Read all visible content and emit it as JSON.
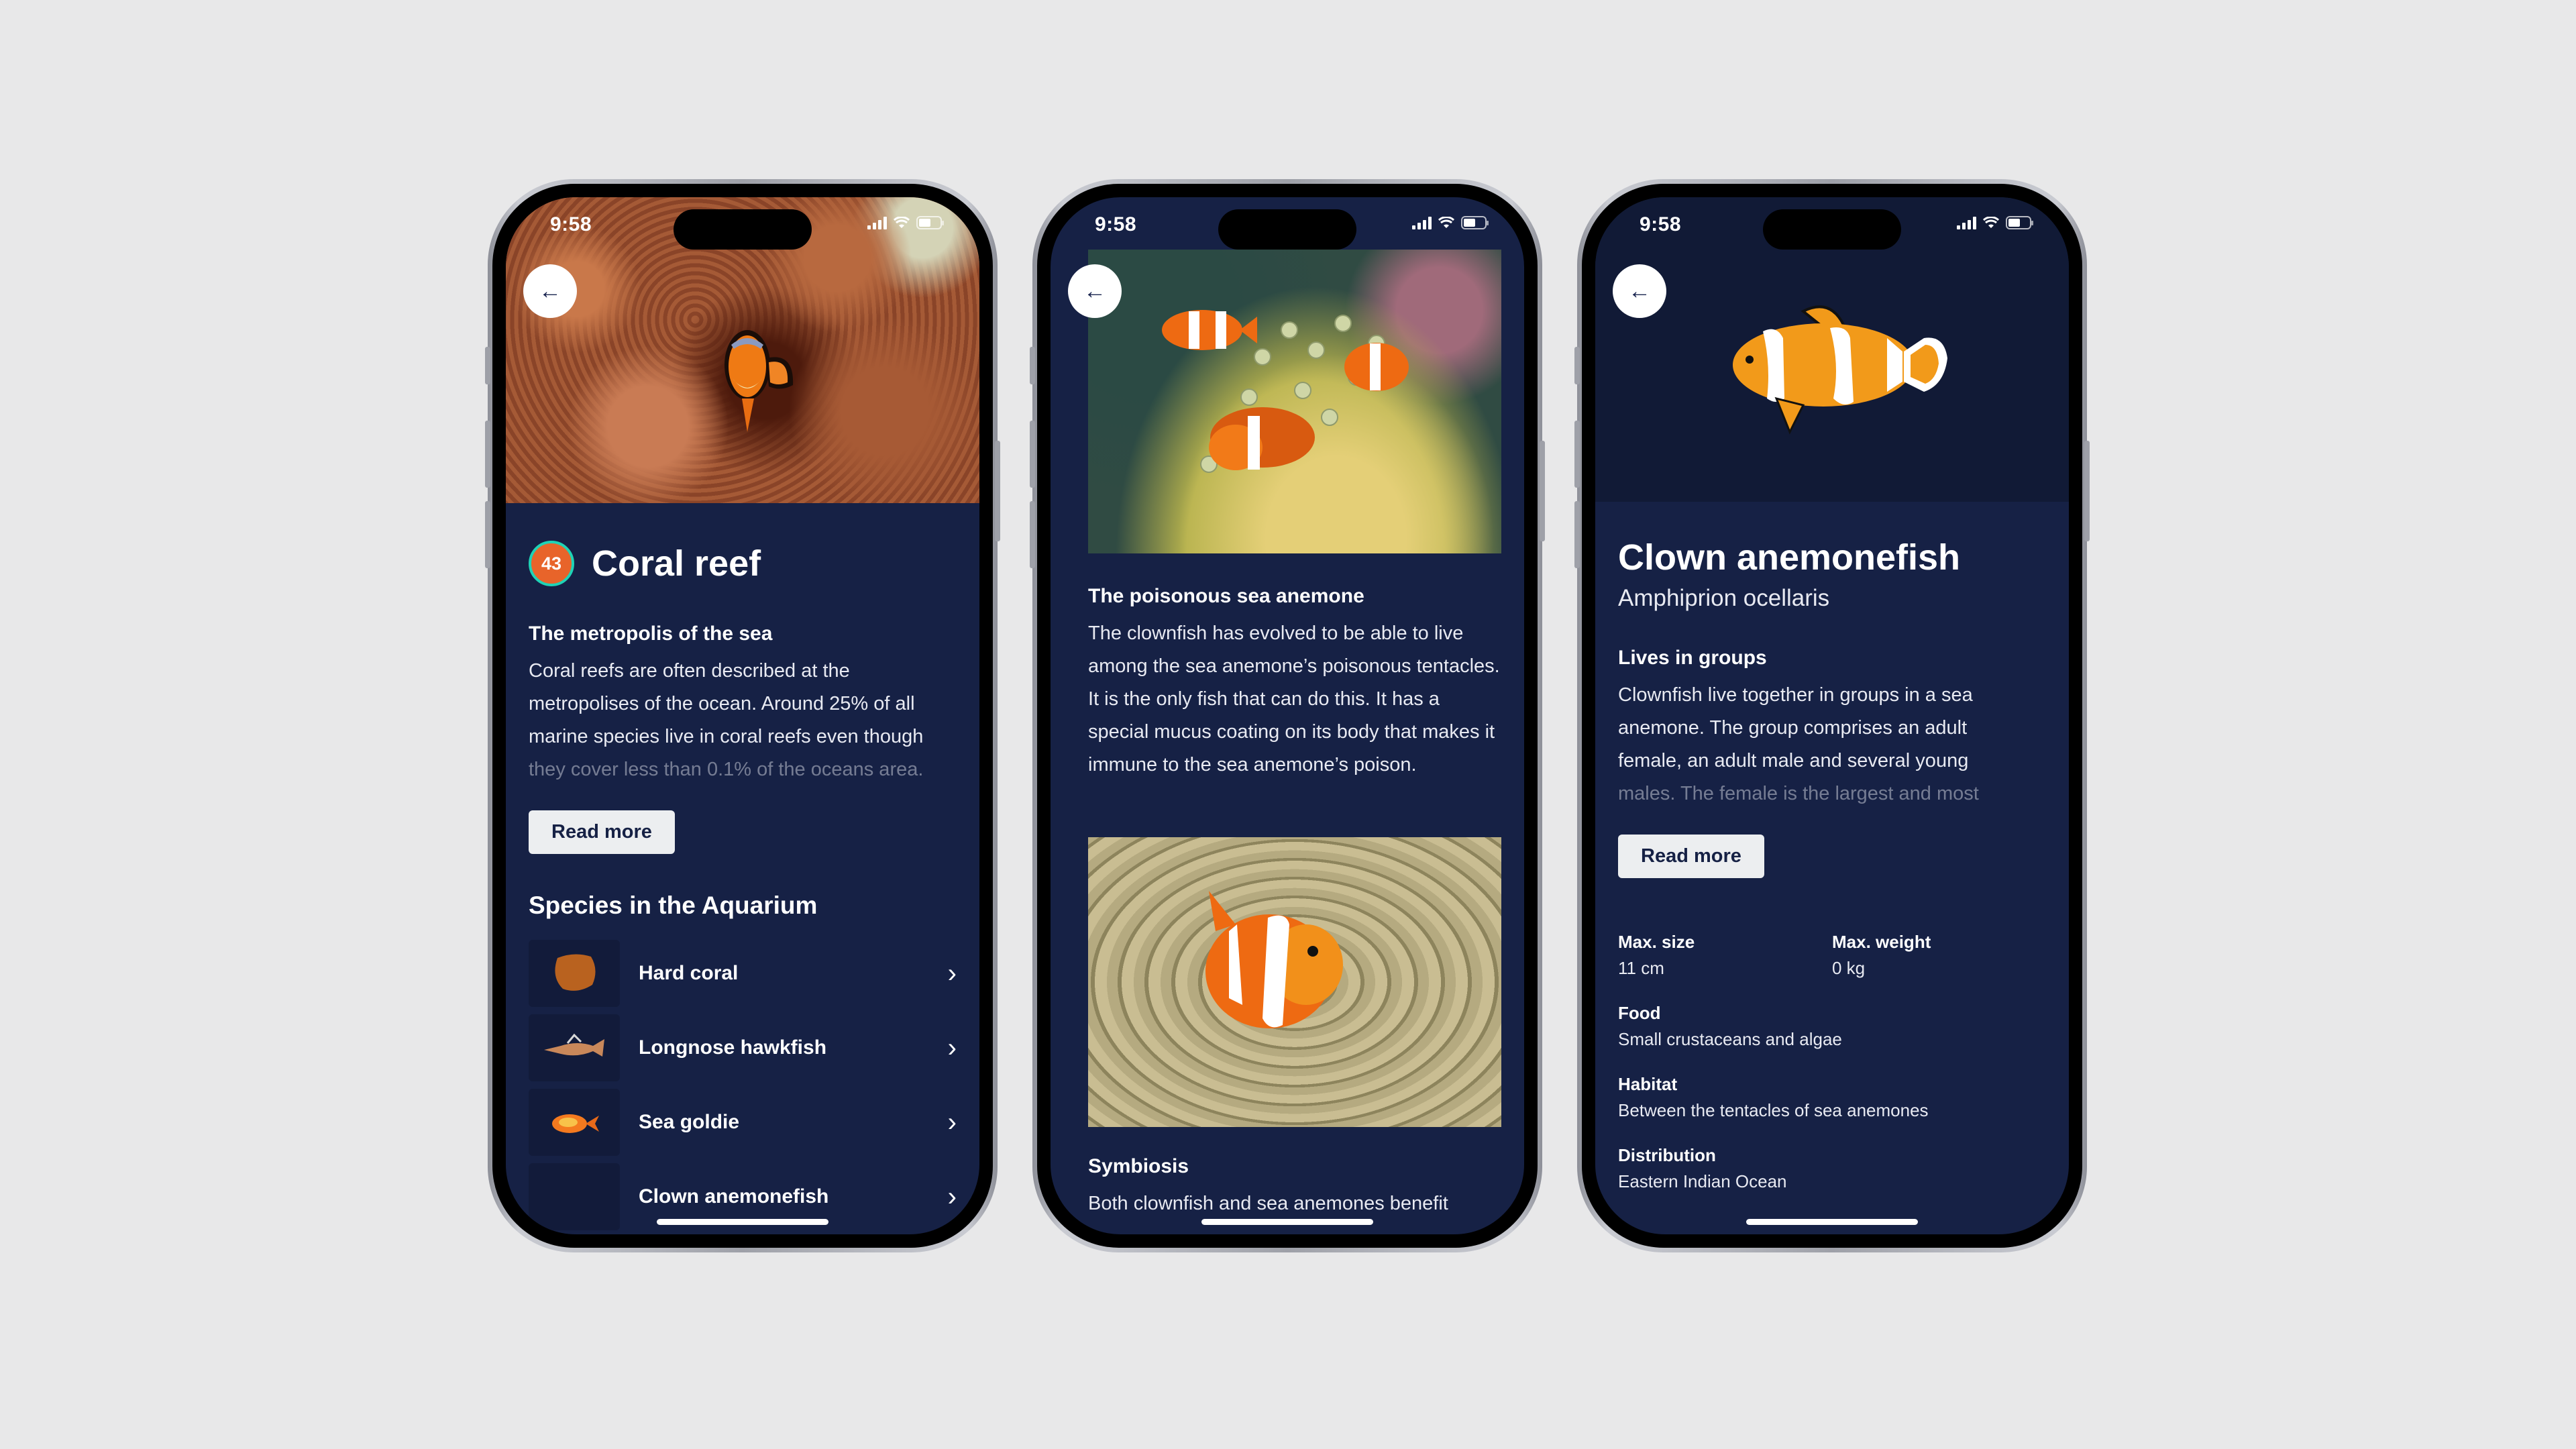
{
  "status_bar": {
    "time": "9:58"
  },
  "screens": [
    {
      "title": "Coral reef",
      "badge_number": "43",
      "section_heading": "The metropolis of the sea",
      "body_lines": [
        "Coral reefs are often described at the",
        "metropolises of the ocean. Around 25% of all",
        "marine species live in coral reefs even though"
      ],
      "body_faded_line": "they cover less than 0.1% of the oceans area.",
      "read_more_label": "Read more",
      "species_heading": "Species in the Aquarium",
      "species": [
        {
          "name": "Hard coral",
          "icon": "hard-coral-thumbnail"
        },
        {
          "name": "Longnose hawkfish",
          "icon": "longnose-hawkfish-thumbnail"
        },
        {
          "name": "Sea goldie",
          "icon": "sea-goldie-thumbnail"
        },
        {
          "name": "Clown anemonefish",
          "icon": "clown-anemonefish-thumbnail"
        }
      ]
    },
    {
      "section1_heading": "The poisonous sea anemone",
      "section1_body": "The clownfish has evolved to be able to live among the sea anemone’s poisonous tentacles. It is the only fish that can do this. It has a special mucus coating on its body that makes it immune to the sea anemone’s poison.",
      "section2_heading": "Symbiosis",
      "section2_body": "Both clownfish and sea anemones benefit"
    },
    {
      "title": "Clown anemonefish",
      "scientific_name": "Amphiprion ocellaris",
      "section_heading": "Lives in groups",
      "body_lines": [
        "Clownfish live together in groups in a sea",
        "anemone. The group comprises an adult",
        "female, an adult male and several young"
      ],
      "body_faded_line": "males. The female is the largest and most",
      "read_more_label": "Read more",
      "facts": {
        "max_size_label": "Max. size",
        "max_size_value": "11 cm",
        "max_weight_label": "Max. weight",
        "max_weight_value": "0 kg",
        "food_label": "Food",
        "food_value": "Small crustaceans and algae",
        "habitat_label": "Habitat",
        "habitat_value": "Between the tentacles of sea anemones",
        "distribution_label": "Distribution",
        "distribution_value": "Eastern Indian Ocean"
      }
    }
  ],
  "icons": {
    "back": "←",
    "chevron": "›"
  },
  "colors": {
    "screen_bg": "#162145",
    "badge_fill": "#e8642a",
    "badge_ring": "#1fd3b6",
    "button_bg": "#eceef0",
    "page_bg": "#e8e8e9"
  }
}
